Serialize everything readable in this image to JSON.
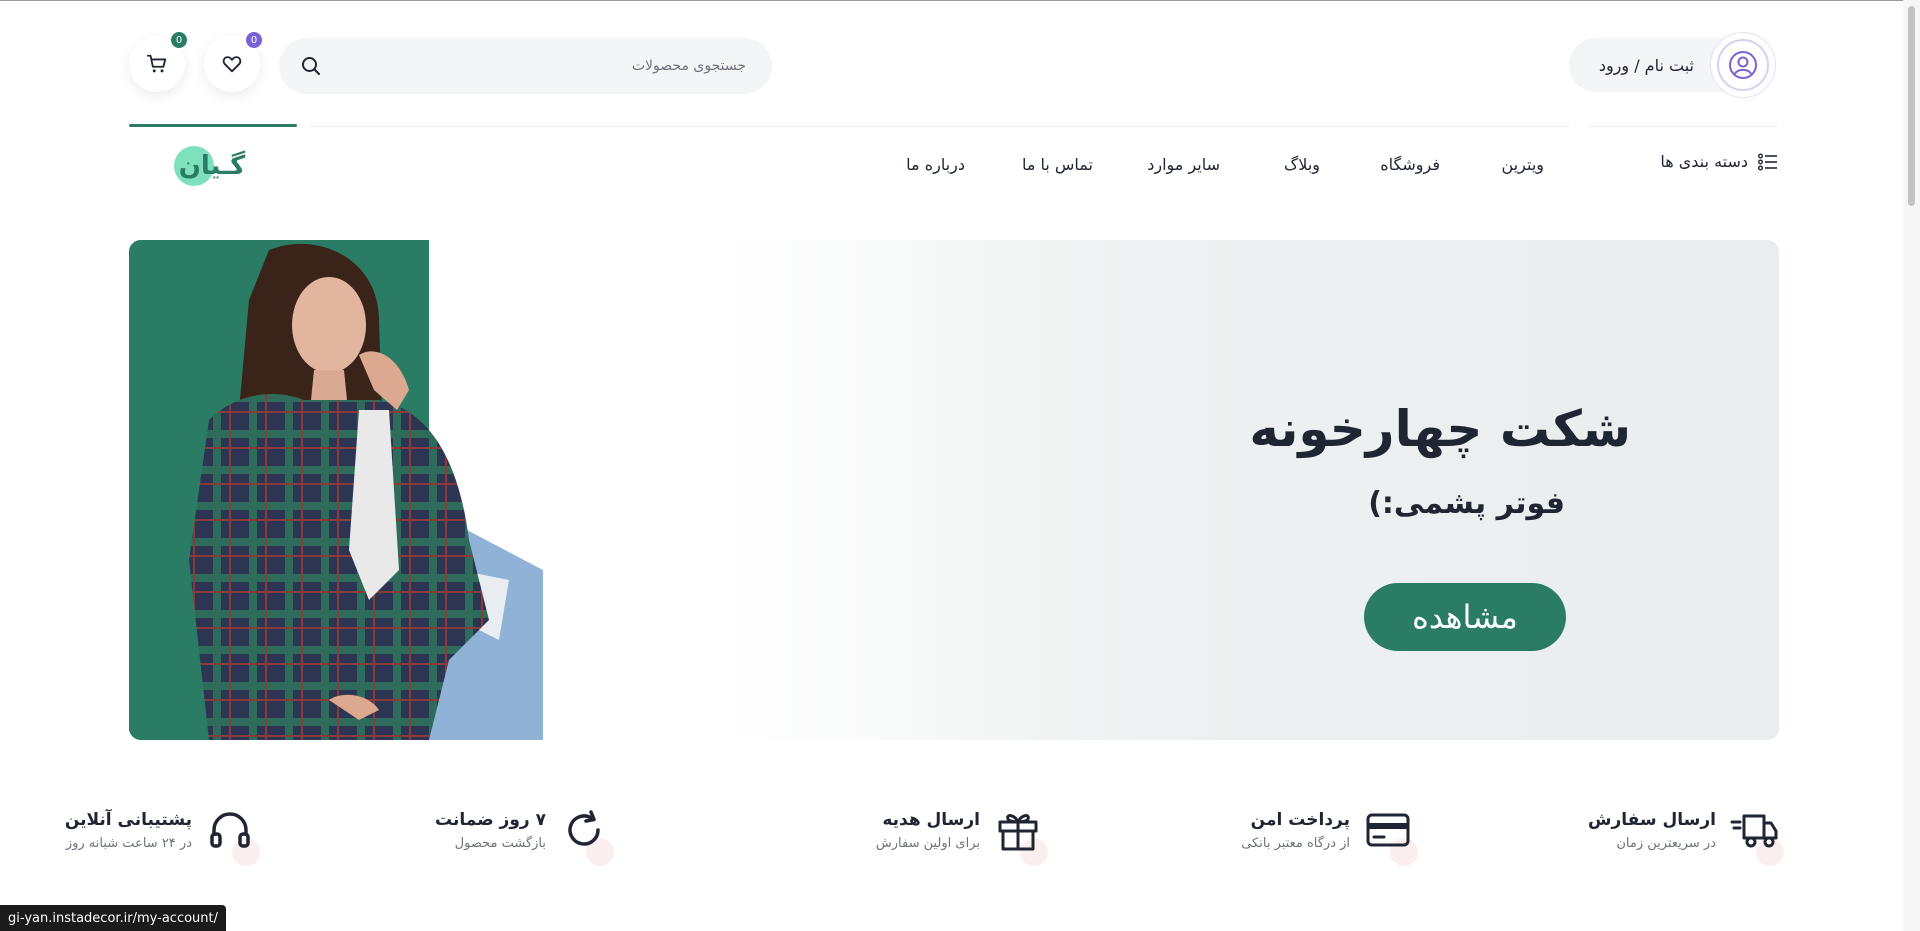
{
  "header": {
    "account_label": "ثبت نام / ورود",
    "search_placeholder": "جستجوی محصولات",
    "wishlist_count": "0",
    "cart_count": "0"
  },
  "nav": {
    "categories_label": "دسته بندی ها",
    "items": [
      "ویترین",
      "فروشگاه",
      "وبلاگ",
      "سایر موارد",
      "تماس با ما",
      "درباره ما"
    ],
    "logo_text": "گـیان"
  },
  "hero": {
    "title": "شکت چهارخونه",
    "subtitle": "فوتر پشمی:)",
    "button_label": "مشاهده"
  },
  "features": [
    {
      "title": "ارسال سفارش",
      "subtitle": "در سریعترین زمان",
      "icon": "truck-icon"
    },
    {
      "title": "پرداخت امن",
      "subtitle": "از درگاه معتبر بانکی",
      "icon": "credit-card-icon"
    },
    {
      "title": "ارسال هدیه",
      "subtitle": "برای اولین سفارش",
      "icon": "gift-icon"
    },
    {
      "title": "۷ روز ضمانت",
      "subtitle": "بازگشت محصول",
      "icon": "refresh-icon"
    },
    {
      "title": "پشتیبانی آنلاین",
      "subtitle": "در ۲۴ ساعت شبانه روز",
      "icon": "headphones-icon"
    }
  ],
  "status_bar": {
    "url": "gi-yan.instadecor.ir/my-account/"
  },
  "colors": {
    "brand": "#2a7d64",
    "accent_purple": "#7b61d6",
    "text": "#1f2533"
  }
}
